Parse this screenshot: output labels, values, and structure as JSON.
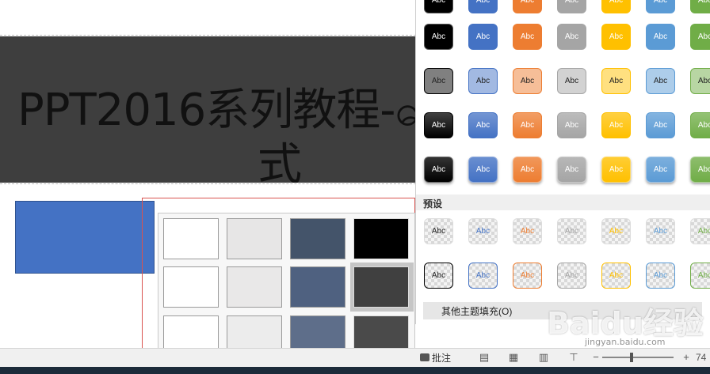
{
  "slide": {
    "title_line1": "PPT2016系列教程-ေ",
    "title_line2": "式"
  },
  "palette": {
    "swatches": [
      [
        "#ffffff",
        "#e7e6e6",
        "#44546a",
        "#000000"
      ],
      [
        "#ffffff",
        "#e9e8e8",
        "#4f6180",
        "#404040"
      ],
      [
        "#ffffff",
        "#ececec",
        "#5e6e8a",
        "#4a4a4a"
      ]
    ],
    "highlighted": "row1-col3"
  },
  "gallery": {
    "tile_label": "Abc",
    "theme_colors": [
      "#000000",
      "#4472c4",
      "#ed7d31",
      "#a5a5a5",
      "#ffc000",
      "#5b9bd5",
      "#70ad47"
    ],
    "preset_label": "预设",
    "more_fills_label": "其他主题填充(O)"
  },
  "status_bar": {
    "comment_label": "批注",
    "zoom_text": "74"
  },
  "watermark": {
    "text": "Baidu经验",
    "url": "jingyan.baidu.com"
  }
}
